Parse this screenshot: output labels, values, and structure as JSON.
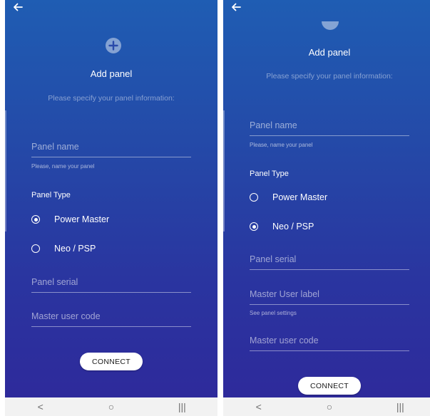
{
  "left_screen": {
    "title": "Add panel",
    "description": "Please specify your panel information:",
    "panel_name_placeholder": "Panel name",
    "panel_name_helper": "Please, name your panel",
    "panel_type_label": "Panel Type",
    "radio_options": [
      "Power Master",
      "Neo / PSP"
    ],
    "selected_option": "Power Master",
    "panel_serial_placeholder": "Panel serial",
    "master_user_code_placeholder": "Master user code",
    "connect_label": "CONNECT"
  },
  "right_screen": {
    "title": "Add panel",
    "description": "Please specify your panel information:",
    "panel_name_placeholder": "Panel name",
    "panel_name_helper": "Please, name your panel",
    "panel_type_label": "Panel Type",
    "radio_options": [
      "Power Master",
      "Neo / PSP"
    ],
    "selected_option": "Neo / PSP",
    "panel_serial_placeholder": "Panel serial",
    "master_user_label_placeholder": "Master User label",
    "master_user_label_helper": "See panel settings",
    "master_user_code_placeholder": "Master user code",
    "connect_label": "CONNECT"
  },
  "navbar": {
    "back": "<",
    "home": "○",
    "recents": "|||"
  },
  "icons": {
    "back": "arrow-left-icon",
    "add": "plus-circle-icon"
  },
  "colors": {
    "gradient_top": "#1f5db3",
    "gradient_bottom": "#2e2a9b",
    "button_bg": "#ffffff",
    "navbar_bg": "#f2f2f2"
  }
}
